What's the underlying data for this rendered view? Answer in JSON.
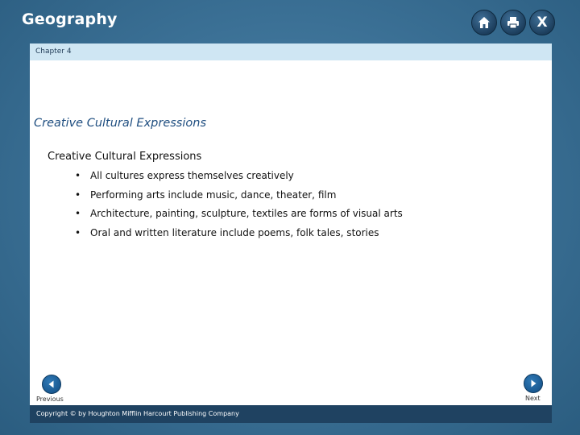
{
  "header": {
    "app_title": "Geography",
    "home_icon": "home-icon",
    "print_icon": "print-icon",
    "close_icon": "close-icon",
    "close_glyph": "X"
  },
  "slide": {
    "chapter_label": "Chapter 4",
    "section_heading": "Creative Cultural Expressions",
    "sub_heading": "Creative Cultural Expressions",
    "bullets": [
      "All cultures express themselves creatively",
      "Performing arts include music, dance, theater, film",
      "Architecture, painting, sculpture, textiles are forms of visual arts",
      "Oral and written literature include poems, folk tales, stories"
    ],
    "nav": {
      "previous_label": "Previous",
      "next_label": "Next"
    },
    "footer": {
      "copyright": "Copyright © by Houghton Mifflin Harcourt Publishing Company"
    }
  },
  "colors": {
    "background": "#3a6f94",
    "chapter_bar": "#cfe6f3",
    "footer_bar": "#1f4261",
    "heading": "#1f4e80"
  }
}
